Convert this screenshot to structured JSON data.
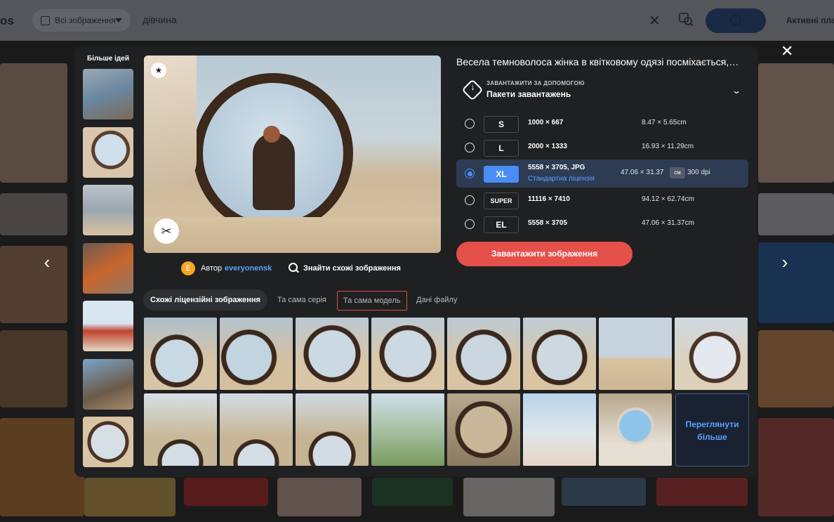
{
  "brand": "os",
  "search": {
    "scope_label": "Всі зображення",
    "query": "дівчина",
    "plans_label": "Активні пла"
  },
  "sidebar": {
    "title": "Більше ідей",
    "thumb_count": 7
  },
  "image": {
    "title": "Весела темноволоса жінка в квітковому одязі посміхається,…",
    "author_initial": "E",
    "author_prefix": "Автор",
    "author_name": "everyonensk",
    "find_similar": "Знайти схожі зображення"
  },
  "download": {
    "kicker": "ЗАВАНТАЖИТИ ЗА ДОПОМОГОЮ",
    "method": "Пакети завантажень",
    "sizes": [
      {
        "code": "S",
        "pixels": "1000 × 667",
        "cm": "8.47 × 5.65cm",
        "selected": false
      },
      {
        "code": "L",
        "pixels": "2000 × 1333",
        "cm": "16.93 × 11.29cm",
        "selected": false
      },
      {
        "code": "XL",
        "pixels": "5558 × 3705, JPG",
        "license": "Стандартна ліцензія",
        "cm": "47.06 × 31.37",
        "unit": "см",
        "dpi": "300 dpi",
        "selected": true
      },
      {
        "code": "SUPER",
        "pixels": "11116 × 7410",
        "cm": "94.12 × 62.74cm",
        "selected": false
      },
      {
        "code": "EL",
        "pixels": "5558 × 3705",
        "cm": "47.06 × 31.37cm",
        "selected": false
      }
    ],
    "button_label": "Завантажити зображення"
  },
  "tabs": [
    {
      "label": "Схожі ліцензійні зображення",
      "active": true
    },
    {
      "label": "Та сама серія",
      "active": false
    },
    {
      "label": "Та сама модель",
      "active": false,
      "highlighted": true
    },
    {
      "label": "Дані файлу",
      "active": false
    }
  ],
  "grid": {
    "view_more_label": "Переглянути\nбільше",
    "tile_count": 15
  },
  "colors": {
    "accent_blue": "#4a8ef5",
    "link_blue": "#5ea0ff",
    "download_red": "#e5504a",
    "modal_bg": "#1f2022",
    "highlight_box": "#e24b3d"
  },
  "icons": {
    "scope": "image-icon",
    "clear": "close-icon",
    "visual_search": "visual-search-icon",
    "search": "search-icon",
    "close_modal": "close-icon",
    "prev": "chevron-left-icon",
    "next": "chevron-right-icon",
    "favorite": "star-icon",
    "crop": "scissors-icon",
    "download_method": "download-diamond-icon",
    "dropdown": "chevron-down-icon"
  }
}
